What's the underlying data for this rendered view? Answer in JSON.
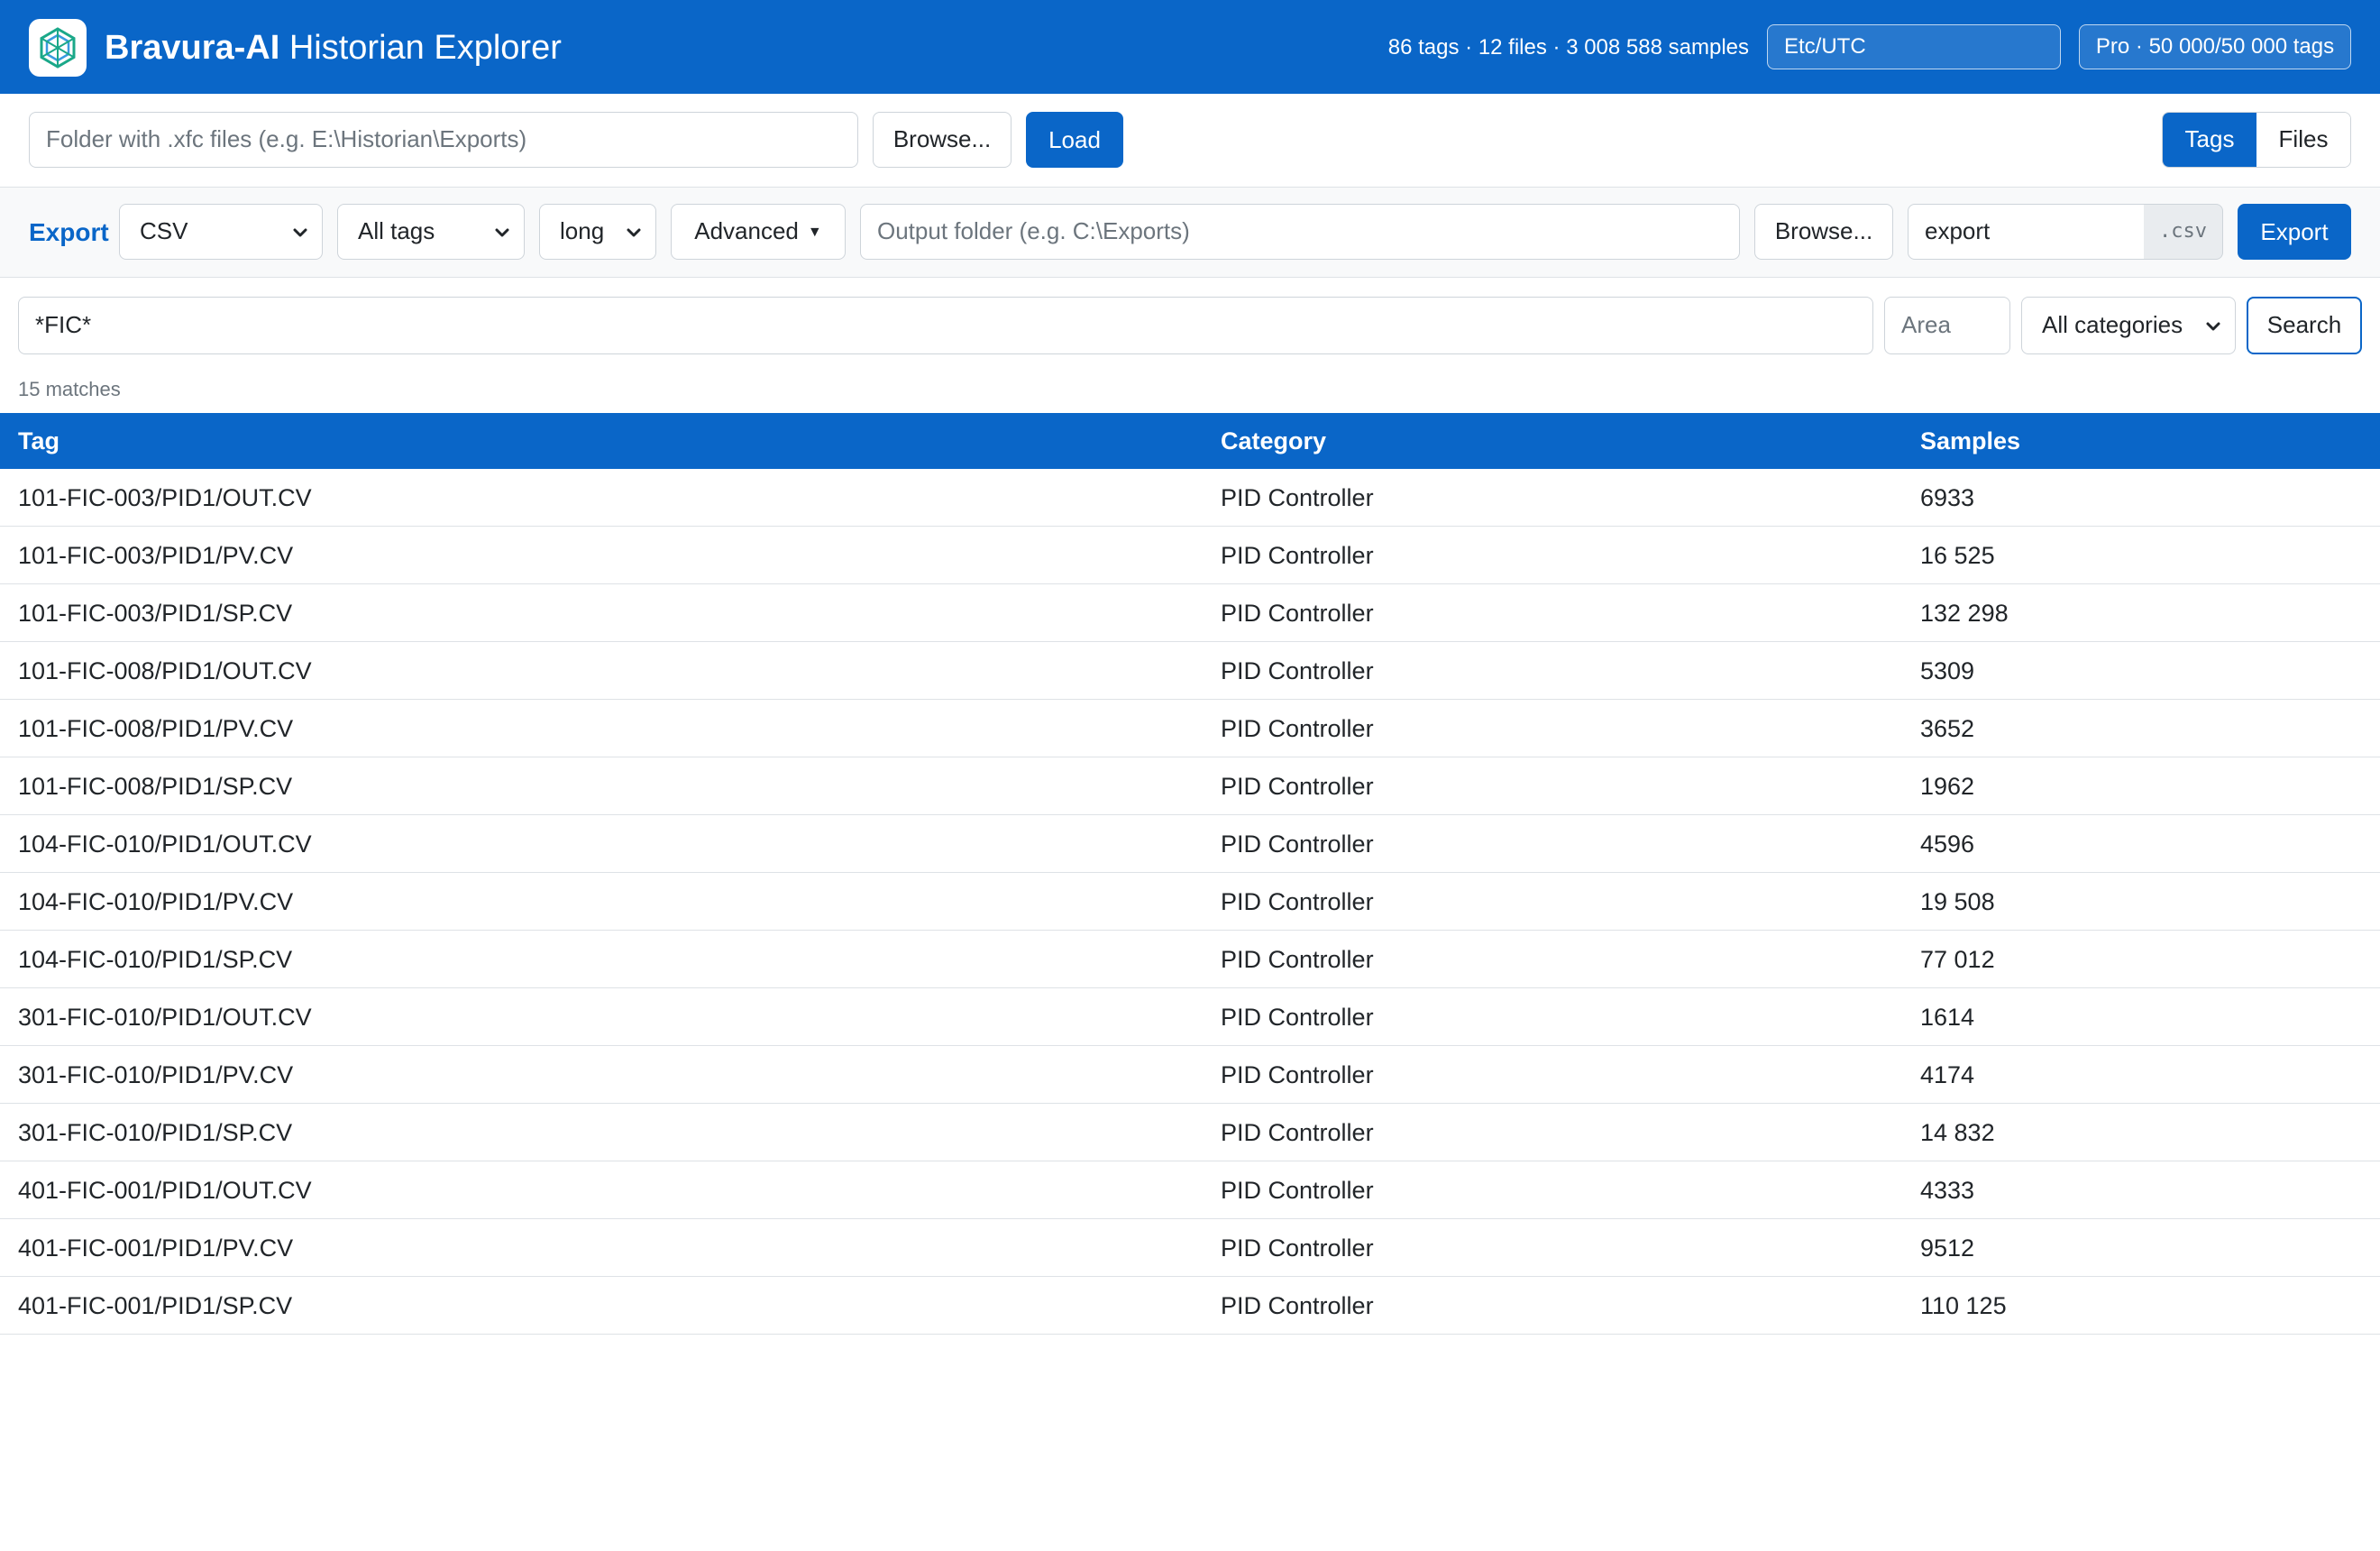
{
  "app": {
    "brand_bold": "Bravura-AI",
    "brand_rest": "Historian Explorer",
    "stats": "86 tags · 12 files · 3 008 588 samples",
    "timezone": "Etc/UTC",
    "license": "Pro · 50 000/50 000 tags",
    "accent_color": "#0a66c8"
  },
  "loader": {
    "folder_placeholder": "Folder with .xfc files (e.g. E:\\Historian\\Exports)",
    "browse_label": "Browse...",
    "load_label": "Load",
    "view_tabs": [
      {
        "label": "Tags",
        "active": true
      },
      {
        "label": "Files",
        "active": false
      }
    ]
  },
  "export": {
    "label": "Export",
    "format": "CSV",
    "scope": "All tags",
    "layout": "long",
    "advanced_label": "Advanced",
    "output_placeholder": "Output folder (e.g. C:\\Exports)",
    "browse_label": "Browse...",
    "filename": "export",
    "extension": ".csv",
    "export_button": "Export"
  },
  "search": {
    "query": "*FIC*",
    "area_placeholder": "Area",
    "category": "All categories",
    "search_button": "Search",
    "matches": "15 matches"
  },
  "table": {
    "columns": [
      "Tag",
      "Category",
      "Samples"
    ],
    "rows": [
      {
        "tag": "101-FIC-003/PID1/OUT.CV",
        "category": "PID Controller",
        "samples": "6933"
      },
      {
        "tag": "101-FIC-003/PID1/PV.CV",
        "category": "PID Controller",
        "samples": "16 525"
      },
      {
        "tag": "101-FIC-003/PID1/SP.CV",
        "category": "PID Controller",
        "samples": "132 298"
      },
      {
        "tag": "101-FIC-008/PID1/OUT.CV",
        "category": "PID Controller",
        "samples": "5309"
      },
      {
        "tag": "101-FIC-008/PID1/PV.CV",
        "category": "PID Controller",
        "samples": "3652"
      },
      {
        "tag": "101-FIC-008/PID1/SP.CV",
        "category": "PID Controller",
        "samples": "1962"
      },
      {
        "tag": "104-FIC-010/PID1/OUT.CV",
        "category": "PID Controller",
        "samples": "4596"
      },
      {
        "tag": "104-FIC-010/PID1/PV.CV",
        "category": "PID Controller",
        "samples": "19 508"
      },
      {
        "tag": "104-FIC-010/PID1/SP.CV",
        "category": "PID Controller",
        "samples": "77 012"
      },
      {
        "tag": "301-FIC-010/PID1/OUT.CV",
        "category": "PID Controller",
        "samples": "1614"
      },
      {
        "tag": "301-FIC-010/PID1/PV.CV",
        "category": "PID Controller",
        "samples": "4174"
      },
      {
        "tag": "301-FIC-010/PID1/SP.CV",
        "category": "PID Controller",
        "samples": "14 832"
      },
      {
        "tag": "401-FIC-001/PID1/OUT.CV",
        "category": "PID Controller",
        "samples": "4333"
      },
      {
        "tag": "401-FIC-001/PID1/PV.CV",
        "category": "PID Controller",
        "samples": "9512"
      },
      {
        "tag": "401-FIC-001/PID1/SP.CV",
        "category": "PID Controller",
        "samples": "110 125"
      }
    ]
  }
}
